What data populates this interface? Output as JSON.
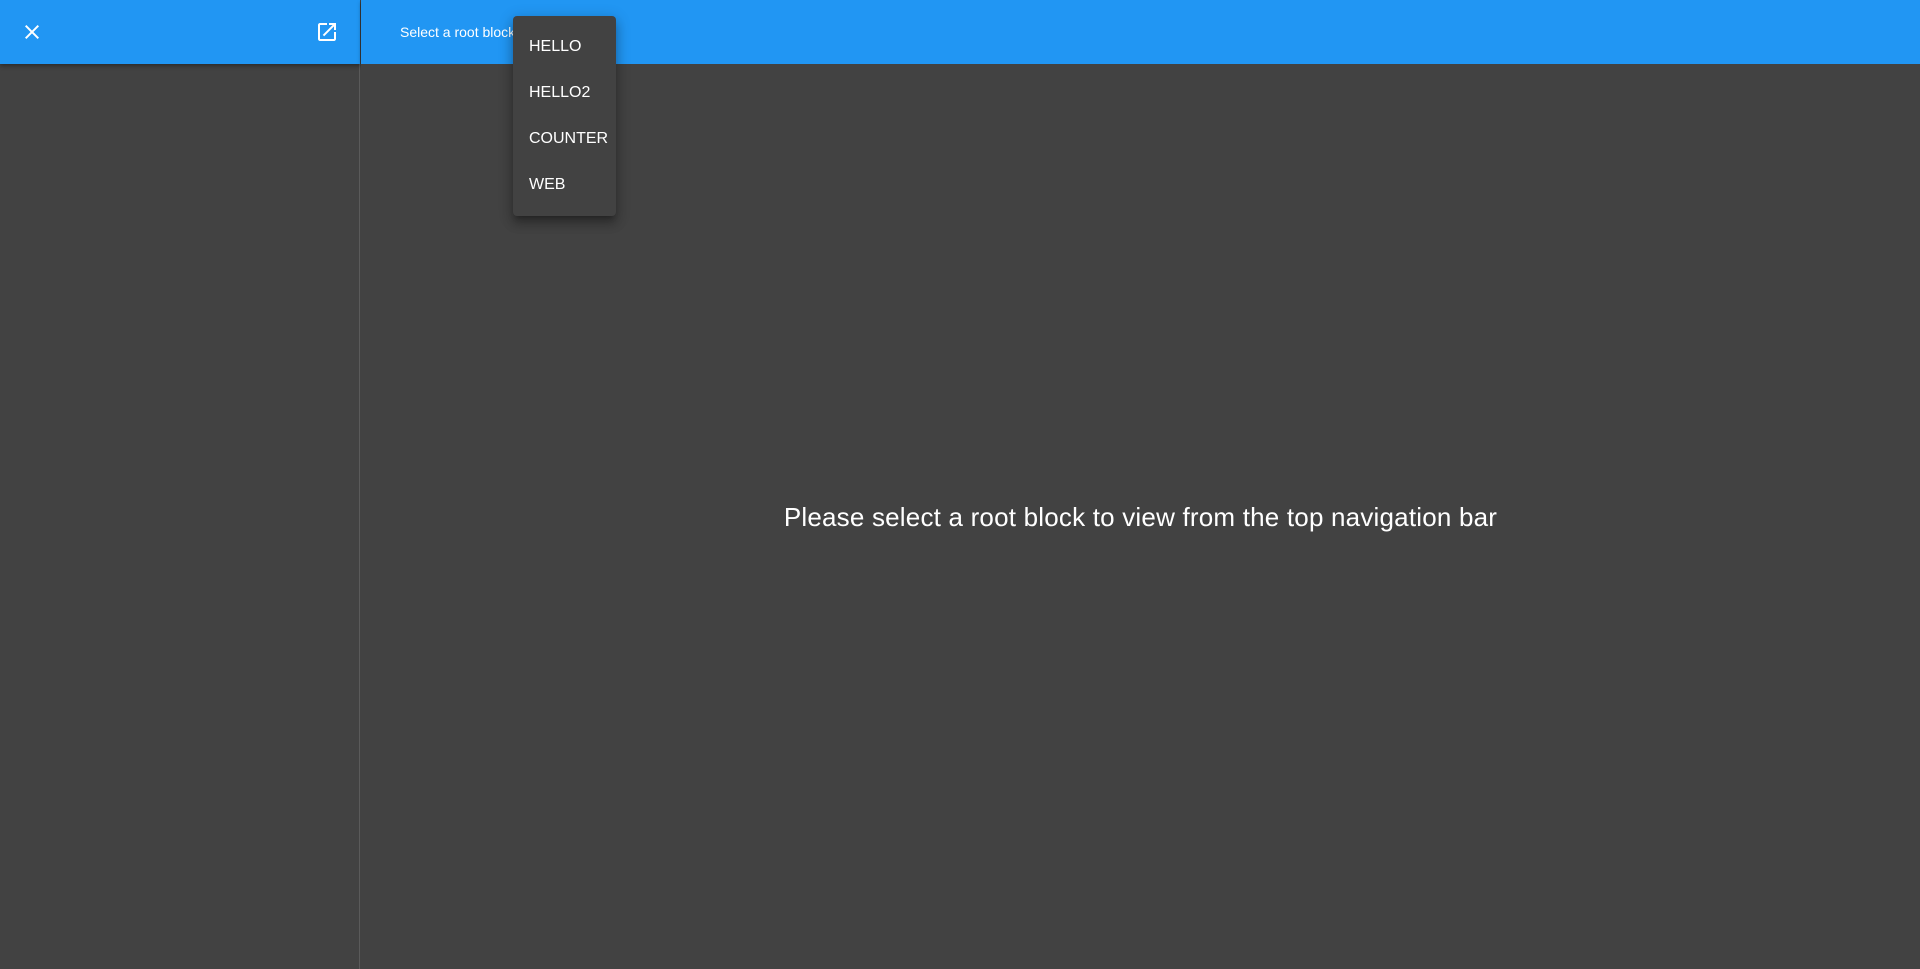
{
  "colors": {
    "appbar": "#2196f3",
    "background": "#424242",
    "text": "#ffffff"
  },
  "drawer": {
    "close_icon": "close-icon",
    "popout_icon": "open-in-new-icon"
  },
  "topbar": {
    "select_label": "Select a root block"
  },
  "menu": {
    "items": [
      {
        "label": "HELLO"
      },
      {
        "label": "HELLO2"
      },
      {
        "label": "COUNTER"
      },
      {
        "label": "WEB"
      }
    ]
  },
  "main": {
    "message": "Please select a root block to view from the top navigation bar"
  }
}
